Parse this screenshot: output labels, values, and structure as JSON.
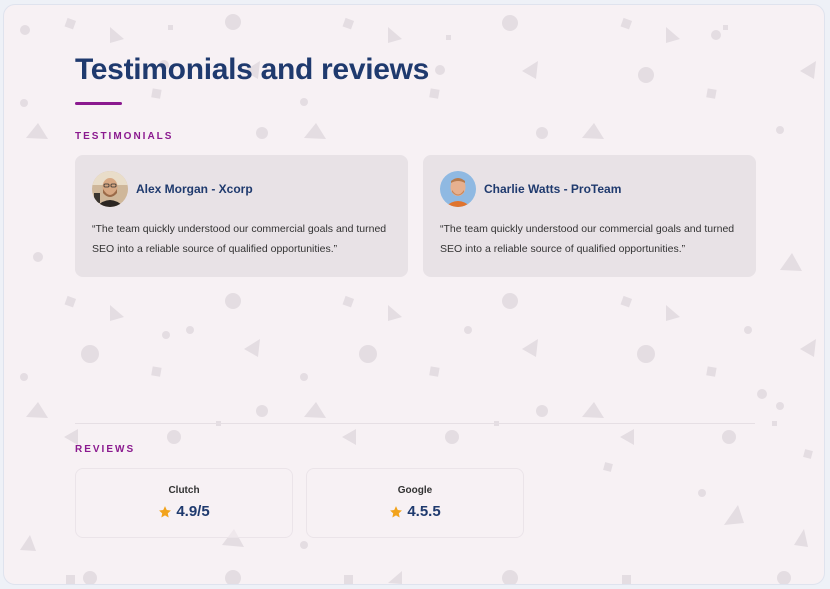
{
  "page": {
    "title": "Testimonials and reviews"
  },
  "testimonials": {
    "heading": "TESTIMONIALS",
    "items": [
      {
        "author": "Alex Morgan - Xcorp",
        "quote": "“The team quickly understood our commercial goals and turned SEO into a reliable source of qualified opportunities.”",
        "avatar_icon": "person-avatar-alex"
      },
      {
        "author": "Charlie Watts - ProTeam",
        "quote": "“The team quickly understood our commercial goals and turned SEO into a reliable source of qualified opportunities.”",
        "avatar_icon": "person-avatar-charlie"
      }
    ]
  },
  "reviews": {
    "heading": "REVIEWS",
    "items": [
      {
        "source": "Clutch",
        "rating": "4.9/5",
        "icon": "star-icon"
      },
      {
        "source": "Google",
        "rating": "4.5.5",
        "icon": "star-icon"
      }
    ]
  },
  "colors": {
    "title": "#1f3a6e",
    "accent": "#8b1a8f",
    "card_bg": "#e8e2e6",
    "page_bg": "#f7f1f4",
    "star": "#f2a31c"
  }
}
